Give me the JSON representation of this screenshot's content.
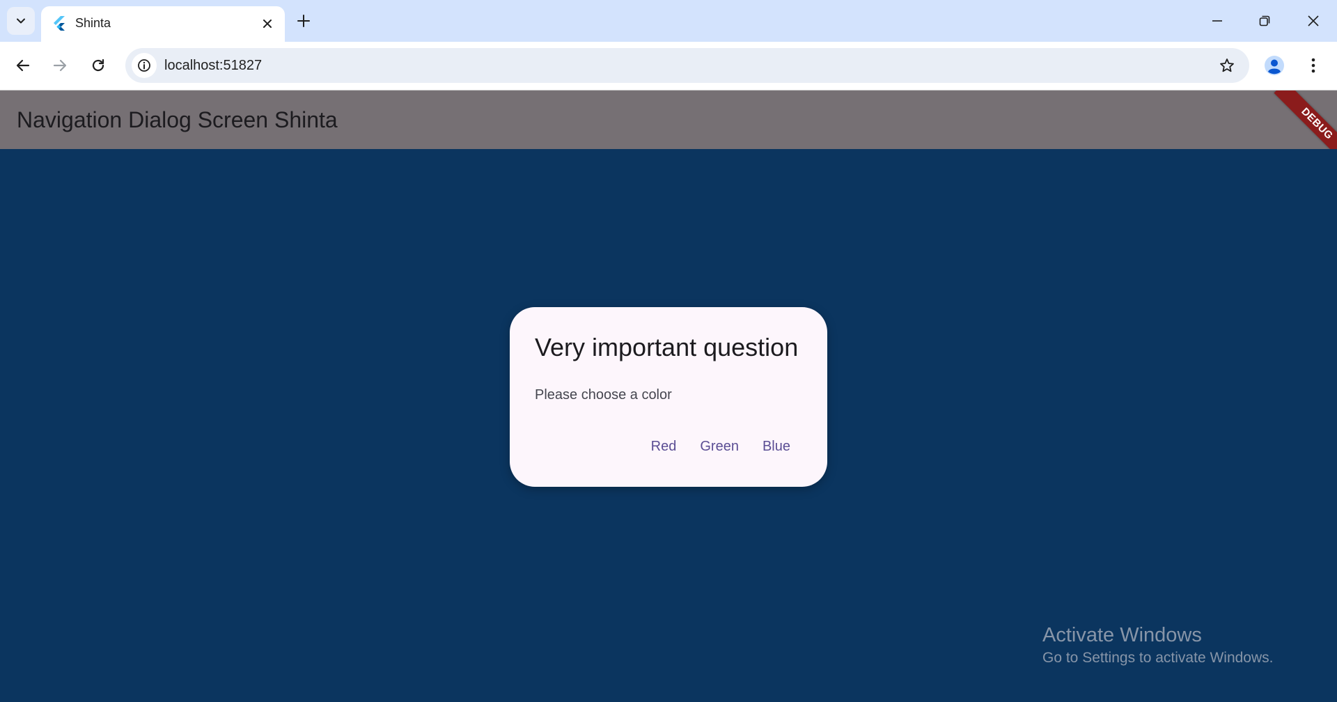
{
  "browser": {
    "tab": {
      "title": "Shinta"
    },
    "address_bar": {
      "url": "localhost:51827"
    }
  },
  "app": {
    "title": "Navigation Dialog Screen Shinta",
    "debug_banner": "DEBUG"
  },
  "dialog": {
    "title": "Very important question",
    "body": "Please choose a color",
    "actions": [
      "Red",
      "Green",
      "Blue"
    ]
  },
  "watermark": {
    "title": "Activate Windows",
    "subtitle": "Go to Settings to activate Windows."
  },
  "colors": {
    "tabstrip": "#d3e3fd",
    "appbar": "#767074",
    "content_background": "#0b355f",
    "dialog_background": "#fdf6fc",
    "action_text": "#5b4e94",
    "debug_banner": "#8b1c1c"
  }
}
